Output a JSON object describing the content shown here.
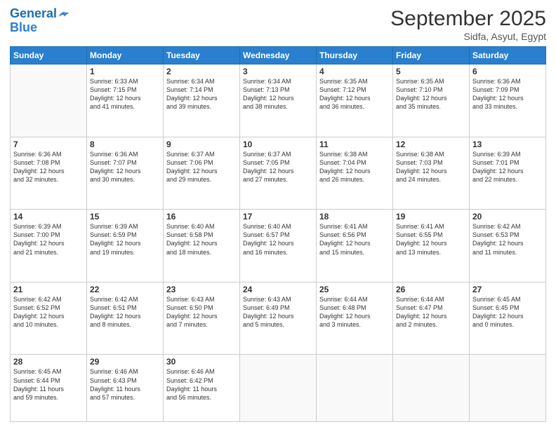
{
  "header": {
    "logo_line1": "General",
    "logo_line2": "Blue",
    "title": "September 2025",
    "location": "Sidfa, Asyut, Egypt"
  },
  "weekdays": [
    "Sunday",
    "Monday",
    "Tuesday",
    "Wednesday",
    "Thursday",
    "Friday",
    "Saturday"
  ],
  "weeks": [
    [
      {
        "day": "",
        "info": ""
      },
      {
        "day": "1",
        "info": "Sunrise: 6:33 AM\nSunset: 7:15 PM\nDaylight: 12 hours\nand 41 minutes."
      },
      {
        "day": "2",
        "info": "Sunrise: 6:34 AM\nSunset: 7:14 PM\nDaylight: 12 hours\nand 39 minutes."
      },
      {
        "day": "3",
        "info": "Sunrise: 6:34 AM\nSunset: 7:13 PM\nDaylight: 12 hours\nand 38 minutes."
      },
      {
        "day": "4",
        "info": "Sunrise: 6:35 AM\nSunset: 7:12 PM\nDaylight: 12 hours\nand 36 minutes."
      },
      {
        "day": "5",
        "info": "Sunrise: 6:35 AM\nSunset: 7:10 PM\nDaylight: 12 hours\nand 35 minutes."
      },
      {
        "day": "6",
        "info": "Sunrise: 6:36 AM\nSunset: 7:09 PM\nDaylight: 12 hours\nand 33 minutes."
      }
    ],
    [
      {
        "day": "7",
        "info": "Sunrise: 6:36 AM\nSunset: 7:08 PM\nDaylight: 12 hours\nand 32 minutes."
      },
      {
        "day": "8",
        "info": "Sunrise: 6:36 AM\nSunset: 7:07 PM\nDaylight: 12 hours\nand 30 minutes."
      },
      {
        "day": "9",
        "info": "Sunrise: 6:37 AM\nSunset: 7:06 PM\nDaylight: 12 hours\nand 29 minutes."
      },
      {
        "day": "10",
        "info": "Sunrise: 6:37 AM\nSunset: 7:05 PM\nDaylight: 12 hours\nand 27 minutes."
      },
      {
        "day": "11",
        "info": "Sunrise: 6:38 AM\nSunset: 7:04 PM\nDaylight: 12 hours\nand 26 minutes."
      },
      {
        "day": "12",
        "info": "Sunrise: 6:38 AM\nSunset: 7:03 PM\nDaylight: 12 hours\nand 24 minutes."
      },
      {
        "day": "13",
        "info": "Sunrise: 6:39 AM\nSunset: 7:01 PM\nDaylight: 12 hours\nand 22 minutes."
      }
    ],
    [
      {
        "day": "14",
        "info": "Sunrise: 6:39 AM\nSunset: 7:00 PM\nDaylight: 12 hours\nand 21 minutes."
      },
      {
        "day": "15",
        "info": "Sunrise: 6:39 AM\nSunset: 6:59 PM\nDaylight: 12 hours\nand 19 minutes."
      },
      {
        "day": "16",
        "info": "Sunrise: 6:40 AM\nSunset: 6:58 PM\nDaylight: 12 hours\nand 18 minutes."
      },
      {
        "day": "17",
        "info": "Sunrise: 6:40 AM\nSunset: 6:57 PM\nDaylight: 12 hours\nand 16 minutes."
      },
      {
        "day": "18",
        "info": "Sunrise: 6:41 AM\nSunset: 6:56 PM\nDaylight: 12 hours\nand 15 minutes."
      },
      {
        "day": "19",
        "info": "Sunrise: 6:41 AM\nSunset: 6:55 PM\nDaylight: 12 hours\nand 13 minutes."
      },
      {
        "day": "20",
        "info": "Sunrise: 6:42 AM\nSunset: 6:53 PM\nDaylight: 12 hours\nand 11 minutes."
      }
    ],
    [
      {
        "day": "21",
        "info": "Sunrise: 6:42 AM\nSunset: 6:52 PM\nDaylight: 12 hours\nand 10 minutes."
      },
      {
        "day": "22",
        "info": "Sunrise: 6:42 AM\nSunset: 6:51 PM\nDaylight: 12 hours\nand 8 minutes."
      },
      {
        "day": "23",
        "info": "Sunrise: 6:43 AM\nSunset: 6:50 PM\nDaylight: 12 hours\nand 7 minutes."
      },
      {
        "day": "24",
        "info": "Sunrise: 6:43 AM\nSunset: 6:49 PM\nDaylight: 12 hours\nand 5 minutes."
      },
      {
        "day": "25",
        "info": "Sunrise: 6:44 AM\nSunset: 6:48 PM\nDaylight: 12 hours\nand 3 minutes."
      },
      {
        "day": "26",
        "info": "Sunrise: 6:44 AM\nSunset: 6:47 PM\nDaylight: 12 hours\nand 2 minutes."
      },
      {
        "day": "27",
        "info": "Sunrise: 6:45 AM\nSunset: 6:45 PM\nDaylight: 12 hours\nand 0 minutes."
      }
    ],
    [
      {
        "day": "28",
        "info": "Sunrise: 6:45 AM\nSunset: 6:44 PM\nDaylight: 11 hours\nand 59 minutes."
      },
      {
        "day": "29",
        "info": "Sunrise: 6:46 AM\nSunset: 6:43 PM\nDaylight: 11 hours\nand 57 minutes."
      },
      {
        "day": "30",
        "info": "Sunrise: 6:46 AM\nSunset: 6:42 PM\nDaylight: 11 hours\nand 56 minutes."
      },
      {
        "day": "",
        "info": ""
      },
      {
        "day": "",
        "info": ""
      },
      {
        "day": "",
        "info": ""
      },
      {
        "day": "",
        "info": ""
      }
    ]
  ]
}
